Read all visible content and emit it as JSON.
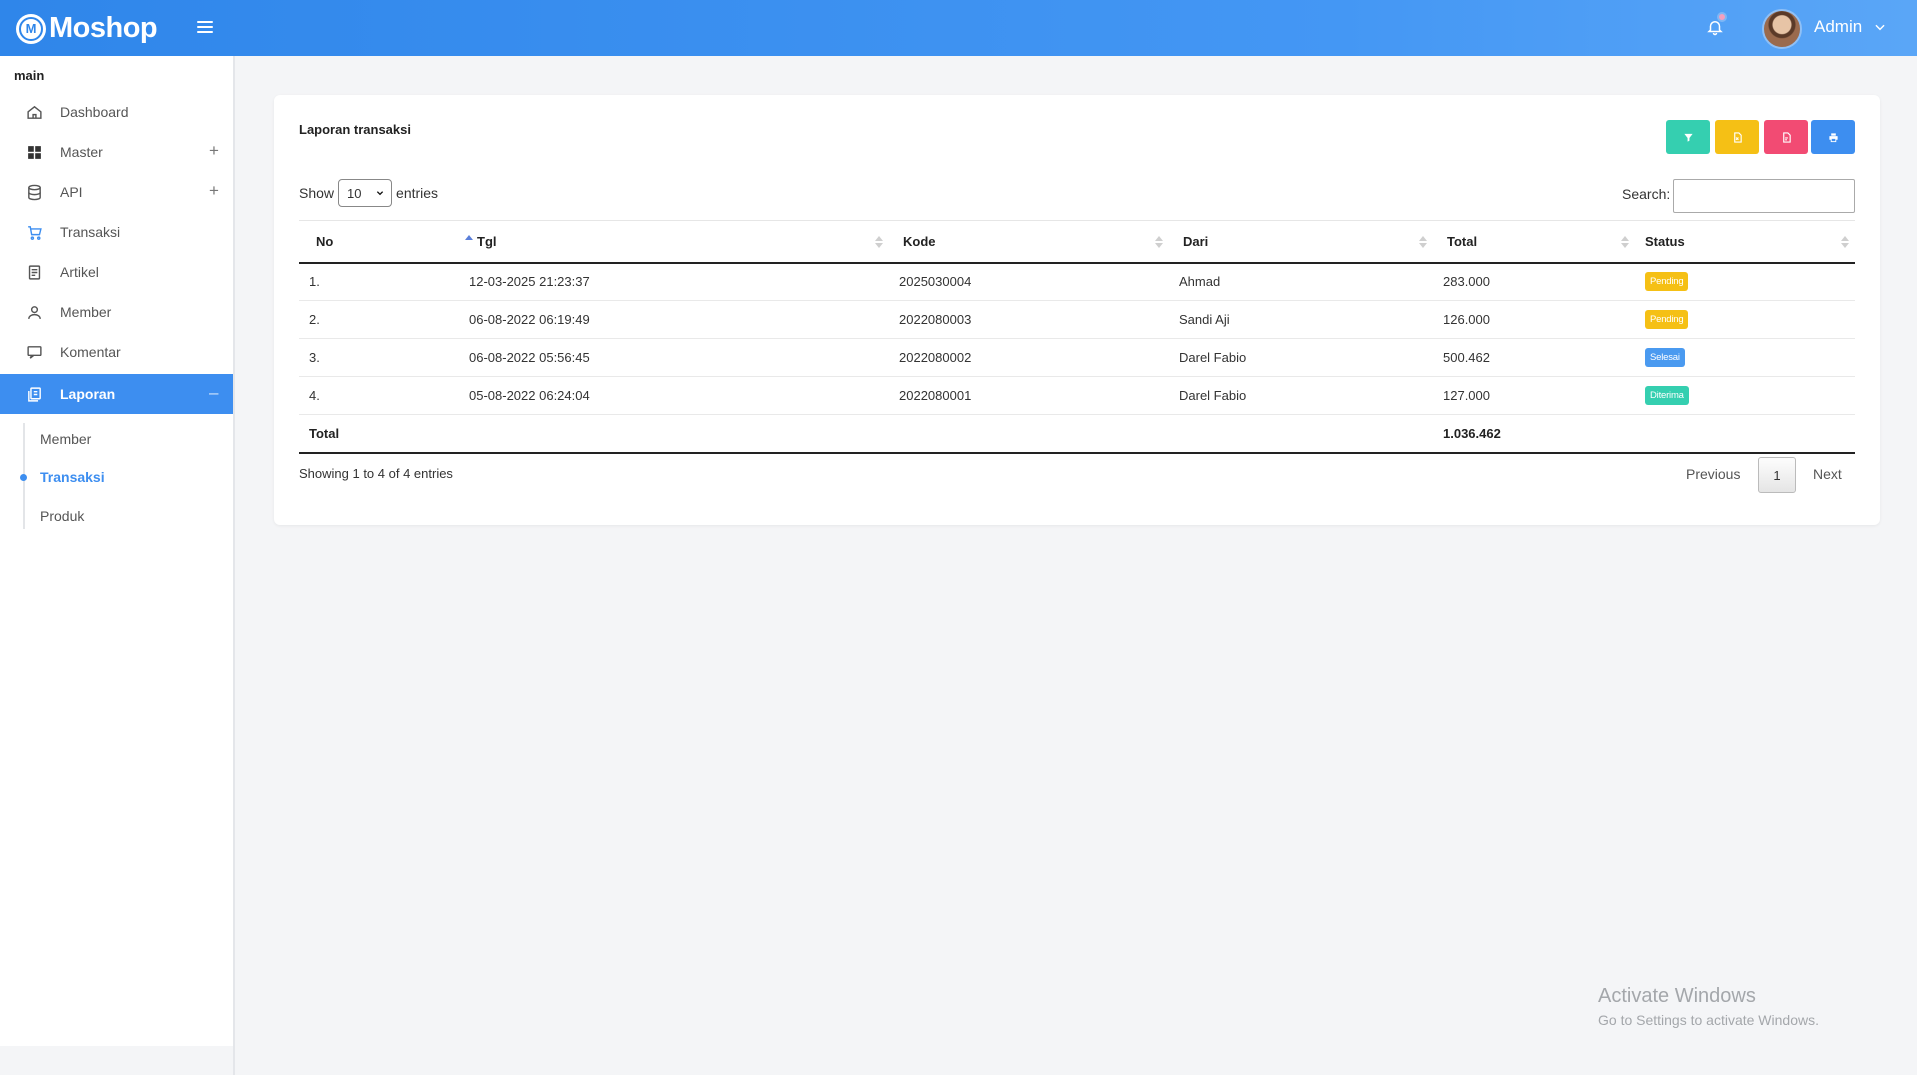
{
  "app": {
    "name": "Moshop"
  },
  "header": {
    "user_name": "Admin"
  },
  "sidebar": {
    "section": "main",
    "items": [
      {
        "label": "Dashboard",
        "icon": "home-icon",
        "expandable": false
      },
      {
        "label": "Master",
        "icon": "grid-icon",
        "expandable": true
      },
      {
        "label": "API",
        "icon": "database-icon",
        "expandable": true
      },
      {
        "label": "Transaksi",
        "icon": "cart-icon",
        "expandable": false
      },
      {
        "label": "Artikel",
        "icon": "article-icon",
        "expandable": false
      },
      {
        "label": "Member",
        "icon": "user-icon",
        "expandable": false
      },
      {
        "label": "Komentar",
        "icon": "comment-icon",
        "expandable": false
      },
      {
        "label": "Laporan",
        "icon": "report-icon",
        "expandable": true,
        "active": true
      }
    ],
    "sub_items": [
      {
        "label": "Member"
      },
      {
        "label": "Transaksi",
        "active": true
      },
      {
        "label": "Produk"
      }
    ]
  },
  "card": {
    "title": "Laporan transaksi",
    "toolbar": [
      {
        "name": "filter-button",
        "icon": "filter-icon",
        "color": "#35cfb0"
      },
      {
        "name": "excel-button",
        "icon": "file-excel-icon",
        "color": "#f5c015"
      },
      {
        "name": "pdf-button",
        "icon": "file-pdf-icon",
        "color": "#f24b73"
      },
      {
        "name": "print-button",
        "icon": "print-icon",
        "color": "#3d8ef0"
      }
    ]
  },
  "table": {
    "show_label": "Show",
    "entries_label": "entries",
    "page_size": "10",
    "search_label": "Search:",
    "columns": [
      "No",
      "Tgl",
      "Kode",
      "Dari",
      "Total",
      "Status"
    ],
    "rows": [
      {
        "no": "1.",
        "tgl": "12-03-2025 21:23:37",
        "kode": "2025030004",
        "dari": "Ahmad",
        "total": "283.000",
        "status": "Pending"
      },
      {
        "no": "2.",
        "tgl": "06-08-2022 06:19:49",
        "kode": "2022080003",
        "dari": "Sandi Aji",
        "total": "126.000",
        "status": "Pending"
      },
      {
        "no": "3.",
        "tgl": "06-08-2022 05:56:45",
        "kode": "2022080002",
        "dari": "Darel Fabio",
        "total": "500.462",
        "status": "Selesai"
      },
      {
        "no": "4.",
        "tgl": "05-08-2022 06:24:04",
        "kode": "2022080001",
        "dari": "Darel Fabio",
        "total": "127.000",
        "status": "Diterima"
      }
    ],
    "total_label": "Total",
    "total_value": "1.036.462",
    "info": "Showing 1 to 4 of 4 entries",
    "pagination": {
      "previous": "Previous",
      "page": "1",
      "next": "Next"
    },
    "status_colors": {
      "Pending": "#f5c015",
      "Selesai": "#4a9af0",
      "Diterima": "#35cfb0"
    }
  },
  "watermark": {
    "line1": "Activate Windows",
    "line2": "Go to Settings to activate Windows."
  }
}
